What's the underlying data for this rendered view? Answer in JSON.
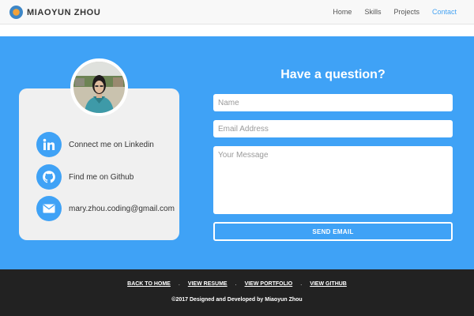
{
  "navbar": {
    "brand": "MIAOYUN ZHOU",
    "links": [
      {
        "label": "Home",
        "active": false
      },
      {
        "label": "Skills",
        "active": false
      },
      {
        "label": "Projects",
        "active": false
      },
      {
        "label": "Contact",
        "active": true
      }
    ]
  },
  "contact_card": {
    "avatar_icon": "profile-photo",
    "items": [
      {
        "icon": "linkedin-icon",
        "label": "Connect me on Linkedin"
      },
      {
        "icon": "github-icon",
        "label": "Find me on Github"
      },
      {
        "icon": "envelope-icon",
        "label": "mary.zhou.coding@gmail.com"
      }
    ]
  },
  "form": {
    "title": "Have a question?",
    "name_placeholder": "Name",
    "email_placeholder": "Email Address",
    "message_placeholder": "Your Message",
    "submit_label": "SEND EMAIL"
  },
  "footer": {
    "links": [
      "BACK TO HOME",
      "VIEW RESUME",
      "VIEW PORTFOLIO",
      "VIEW GITHUB"
    ],
    "separator": ".",
    "copyright": "©2017 Designed and Developed by Miaoyun Zhou"
  },
  "colors": {
    "accent": "#3fa2f6",
    "active_nav": "#45a3f3",
    "footer_bg": "#222222",
    "card_bg": "#f0f0f0"
  }
}
